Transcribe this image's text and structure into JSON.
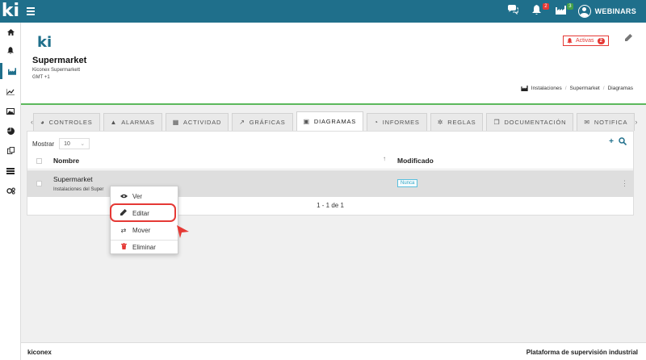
{
  "topbar": {
    "logo": "ki",
    "alerts_badge": "2",
    "notifications_badge": "3",
    "user_label": "WEBINARS"
  },
  "header": {
    "brand": "ki",
    "title": "Supermarket",
    "subtitle": "Kiconex Supermarkett",
    "timezone": "GMT +1",
    "activas_label": "Activas",
    "activas_count": "2",
    "breadcrumb": [
      "Instalaciones",
      "Supermarket",
      "Diagramas"
    ]
  },
  "tabs": [
    {
      "label": "CONTROLES",
      "icon": "gauge-icon"
    },
    {
      "label": "ALARMAS",
      "icon": "bell-icon"
    },
    {
      "label": "ACTIVIDAD",
      "icon": "calendar-icon"
    },
    {
      "label": "GRÁFICAS",
      "icon": "chart-icon"
    },
    {
      "label": "DIAGRAMAS",
      "icon": "image-icon",
      "active": true
    },
    {
      "label": "INFORMES",
      "icon": "pie-icon"
    },
    {
      "label": "REGLAS",
      "icon": "gears-icon"
    },
    {
      "label": "DOCUMENTACIÓN",
      "icon": "copy-icon"
    },
    {
      "label": "NOTIFICA",
      "icon": "envelope-icon"
    }
  ],
  "table": {
    "show_label": "Mostrar",
    "page_size": "10",
    "columns": [
      "Nombre",
      "Modificado"
    ],
    "rows": [
      {
        "name": "Supermarket",
        "sub": "Instalaciones del Super",
        "modified": "Nunca"
      }
    ],
    "pager": "1 - 1 de 1"
  },
  "menu": {
    "items": [
      {
        "label": "Ver",
        "icon": "eye-icon"
      },
      {
        "label": "Editar",
        "icon": "pencil-icon"
      },
      {
        "label": "Mover",
        "icon": "shuffle-icon"
      },
      {
        "label": "Eliminar",
        "icon": "trash-icon"
      }
    ]
  },
  "footer": {
    "left": "kiconex",
    "right": "Plataforma de supervisión industrial"
  },
  "colors": {
    "primary": "#1f6f8b",
    "accent_green": "#5cb85c",
    "danger": "#e53935"
  }
}
